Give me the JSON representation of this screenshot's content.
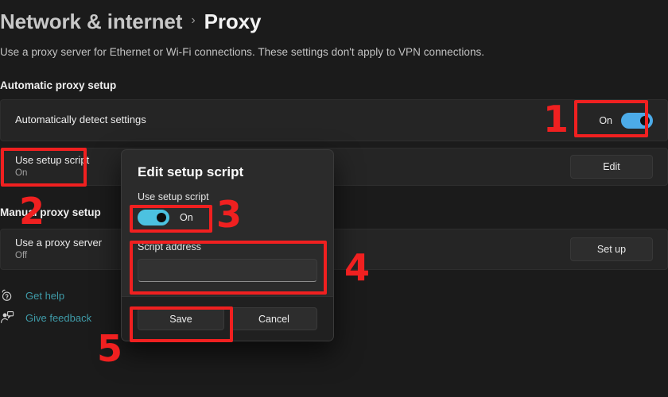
{
  "breadcrumb": {
    "parent": "Network & internet",
    "separator": "›",
    "current": "Proxy"
  },
  "subtitle": "Use a proxy server for Ethernet or Wi-Fi connections. These settings don't apply to VPN connections.",
  "sections": {
    "automatic_heading": "Automatic proxy setup",
    "manual_heading": "Manual proxy setup"
  },
  "settings": {
    "auto_detect": {
      "title": "Automatically detect settings",
      "toggle_label": "On",
      "toggle_state": "on"
    },
    "use_setup_script": {
      "title": "Use setup script",
      "status": "On",
      "button_label": "Edit"
    },
    "use_proxy_server": {
      "title": "Use a proxy server",
      "status": "Off",
      "button_label": "Set up"
    }
  },
  "links": [
    {
      "label": "Get help",
      "icon": "help-question-icon"
    },
    {
      "label": "Give feedback",
      "icon": "feedback-person-icon"
    }
  ],
  "dialog": {
    "title": "Edit setup script",
    "toggle_caption": "Use setup script",
    "toggle_label": "On",
    "toggle_state": "on",
    "field_label": "Script address",
    "field_value": "",
    "field_placeholder": "",
    "save_label": "Save",
    "cancel_label": "Cancel"
  },
  "annotations": [
    {
      "number": "1",
      "target": "auto-detect-toggle"
    },
    {
      "number": "2",
      "target": "use-setup-script-card"
    },
    {
      "number": "3",
      "target": "dialog-use-setup-script-toggle"
    },
    {
      "number": "4",
      "target": "dialog-script-address-field"
    },
    {
      "number": "5",
      "target": "dialog-save-button"
    }
  ],
  "colors": {
    "page_background": "#1b1b1b",
    "card_background": "#252525",
    "dialog_background": "#2b2b2b",
    "accent_toggle": "#4cabe8",
    "dialog_toggle": "#4cc2e0",
    "link": "#3f9ba8",
    "annotation_red": "#f02020"
  }
}
